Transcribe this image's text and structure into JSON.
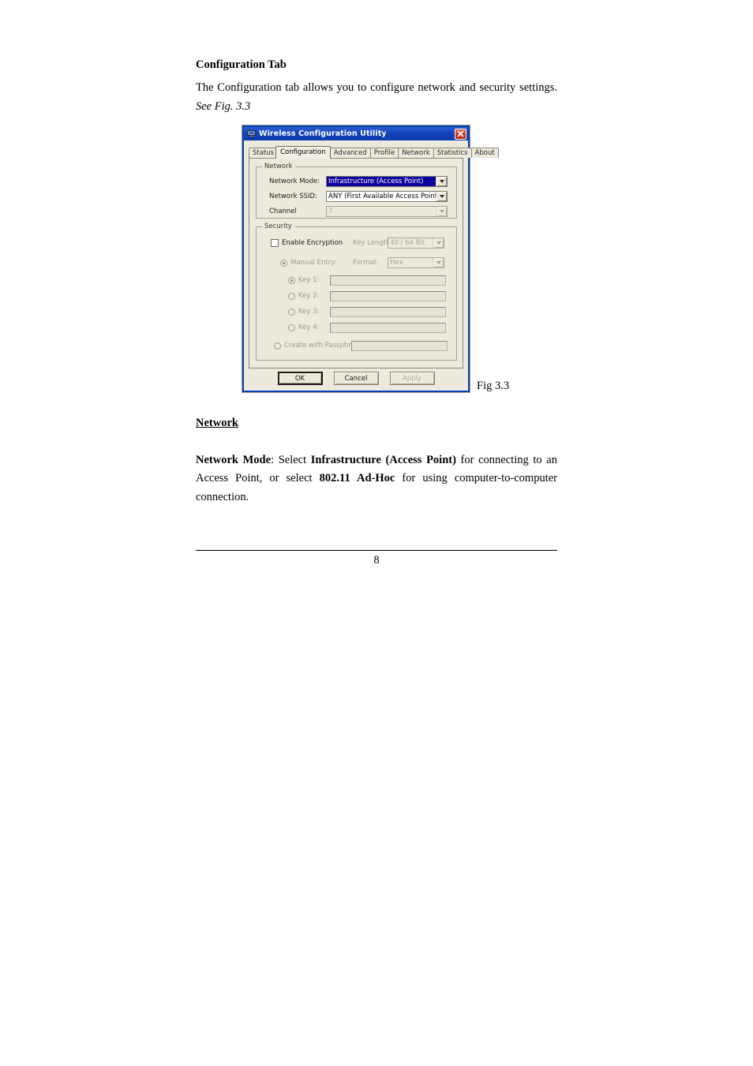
{
  "document": {
    "heading": "Configuration Tab",
    "intro_text": "The Configuration tab allows you to configure network and security settings. ",
    "intro_italic": "See Fig. 3.3",
    "figure_caption": "Fig 3.3",
    "section_heading": "Network",
    "body": {
      "lead_bold": "Network Mode",
      "part1": ": Select ",
      "bold1": "Infrastructure (Access Point)",
      "part2": " for connecting to an Access Point, or select ",
      "bold2": "802.11 Ad-Hoc",
      "part3": " for using computer-to-computer connection."
    },
    "page_number": "8"
  },
  "dialog": {
    "title": "Wireless Configuration Utility",
    "title_icon": "computer-icon",
    "close_icon": "close-icon",
    "tabs": [
      {
        "label": "Status",
        "active": false
      },
      {
        "label": "Configuration",
        "active": true
      },
      {
        "label": "Advanced",
        "active": false
      },
      {
        "label": "Profile",
        "active": false
      },
      {
        "label": "Network",
        "active": false
      },
      {
        "label": "Statistics",
        "active": false
      },
      {
        "label": "About",
        "active": false
      }
    ],
    "network_group": {
      "legend": "Network",
      "network_mode_label": "Network Mode:",
      "network_mode_value": "Infrastructure (Access Point)",
      "network_ssid_label": "Network SSID:",
      "network_ssid_value": "ANY (First Available Access Point)",
      "channel_label": "Channel",
      "channel_value": "7"
    },
    "security_group": {
      "legend": "Security",
      "enable_encryption_label": "Enable Encryption",
      "key_length_label": "Key Length:",
      "key_length_value": "40 / 64 Bit",
      "manual_entry_label": "Manual Entry:",
      "format_label": "Format:",
      "format_value": "Hex",
      "key1_label": "Key 1:",
      "key1_value": "",
      "key2_label": "Key 2:",
      "key2_value": "",
      "key3_label": "Key 3:",
      "key3_value": "",
      "key4_label": "Key 4:",
      "key4_value": "",
      "passphrase_label": "Create with Passphrase:",
      "passphrase_value": ""
    },
    "buttons": {
      "ok": "OK",
      "cancel": "Cancel",
      "apply": "Apply"
    },
    "colors": {
      "titlebar_blue": "#0c39ad",
      "selection_blue": "#0a009c",
      "dialog_face": "#ece9dd",
      "close_red": "#d33b22"
    }
  }
}
